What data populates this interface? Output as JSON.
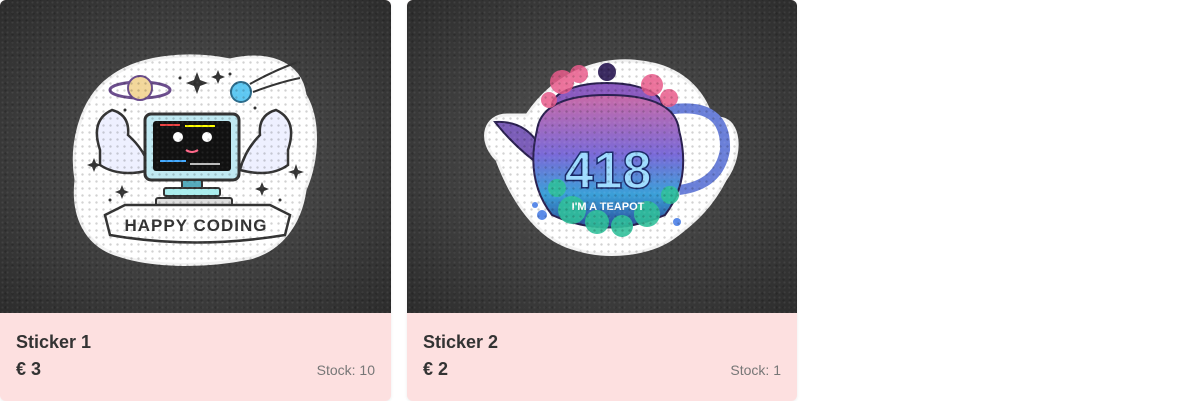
{
  "products": [
    {
      "name": "Sticker 1",
      "price": "€ 3",
      "stock_label": "Stock",
      "stock_value": "10",
      "image": {
        "icon": "happy-coding-sticker",
        "text": "HAPPY CODING"
      }
    },
    {
      "name": "Sticker 2",
      "price": "€ 2",
      "stock_label": "Stock",
      "stock_value": "1",
      "image": {
        "icon": "teapot-418-sticker",
        "code": "418",
        "caption": "I'M A TEAPOT"
      }
    }
  ],
  "colors": {
    "card_bg": "#fde0e0",
    "text": "#333333",
    "muted": "#777777"
  }
}
